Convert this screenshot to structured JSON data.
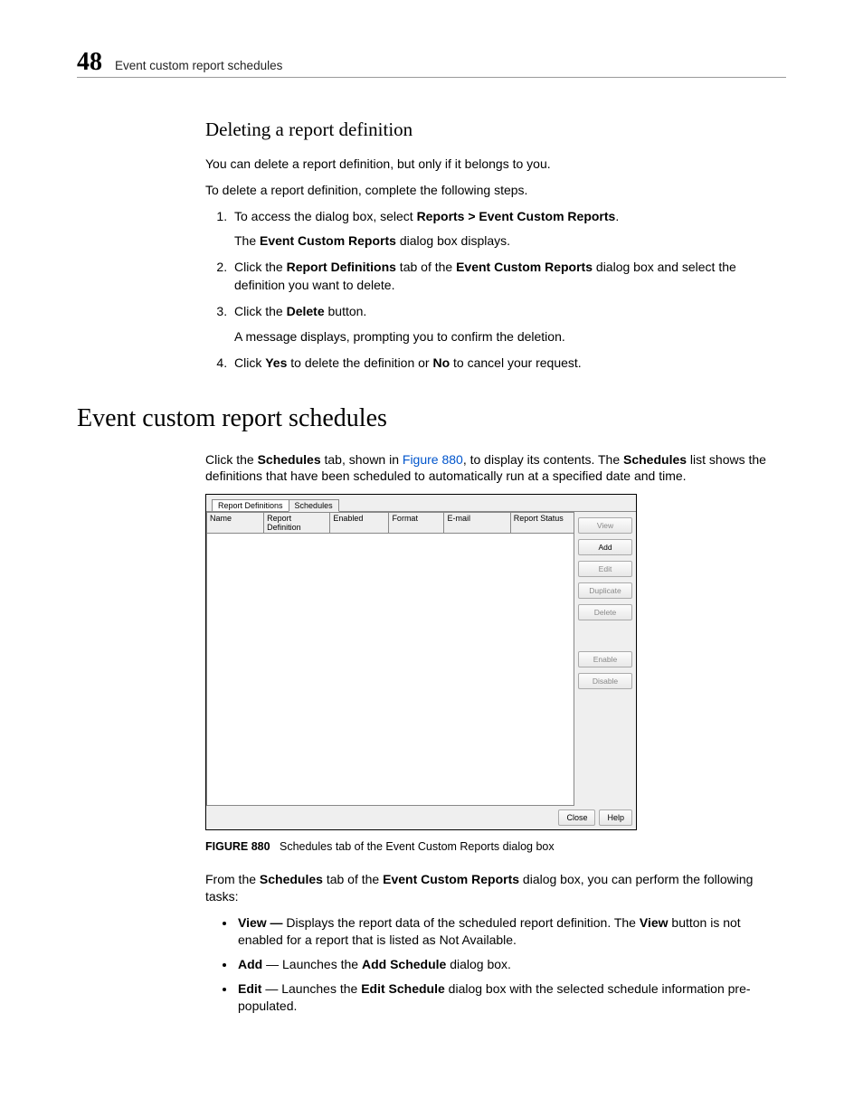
{
  "header": {
    "chapter_number": "48",
    "title": "Event custom report schedules"
  },
  "section1": {
    "heading": "Deleting a report definition",
    "p1": "You can delete a report definition, but only if it belongs to you.",
    "p2": "To delete a report definition, complete the following steps.",
    "steps": {
      "s1_pre": "To access the dialog box, select ",
      "s1_bold": "Reports > Event Custom Reports",
      "s1_post": ".",
      "s1_sub_pre": "The ",
      "s1_sub_bold": "Event Custom Reports",
      "s1_sub_post": " dialog box displays.",
      "s2_pre": "Click the ",
      "s2_bold1": "Report Definitions",
      "s2_mid": " tab of the ",
      "s2_bold2": "Event Custom Reports",
      "s2_post": " dialog box and select the definition you want to delete.",
      "s3_pre": "Click the ",
      "s3_bold": "Delete",
      "s3_post": " button.",
      "s3_sub": "A message displays, prompting you to confirm the deletion.",
      "s4_pre": "Click ",
      "s4_bold1": "Yes",
      "s4_mid": " to delete the definition or ",
      "s4_bold2": "No",
      "s4_post": " to cancel your request."
    }
  },
  "section2": {
    "heading": "Event custom report schedules",
    "intro_pre": "Click the ",
    "intro_bold1": "Schedules",
    "intro_mid1": " tab, shown in ",
    "intro_link": "Figure 880",
    "intro_mid2": ", to display its contents. The ",
    "intro_bold2": "Schedules",
    "intro_post": " list shows the definitions that have been scheduled to automatically run at a specified date and time.",
    "dialog": {
      "tabs": [
        "Report Definitions",
        "Schedules"
      ],
      "columns": [
        "Name",
        "Report Definition",
        "Enabled",
        "Format",
        "E-mail",
        "Report Status"
      ],
      "buttons": {
        "view": "View",
        "add": "Add",
        "edit": "Edit",
        "duplicate": "Duplicate",
        "delete": "Delete",
        "enable": "Enable",
        "disable": "Disable",
        "close": "Close",
        "help": "Help"
      }
    },
    "caption_label": "FIGURE 880",
    "caption_text": "Schedules tab of the Event Custom Reports dialog box",
    "p_after_pre": "From the ",
    "p_after_bold1": "Schedules",
    "p_after_mid": " tab of the ",
    "p_after_bold2": "Event Custom Reports",
    "p_after_post": " dialog box, you can perform the following tasks:",
    "bullets": {
      "b1_bold": "View —",
      "b1_text_pre": " Displays the report data of the scheduled report definition. The ",
      "b1_bold2": "View",
      "b1_text_post": " button is not enabled for a report that is listed as Not Available.",
      "b2_bold": "Add",
      "b2_mid": " — Launches the ",
      "b2_bold2": "Add Schedule",
      "b2_post": " dialog box.",
      "b3_bold": "Edit",
      "b3_mid": " — Launches the ",
      "b3_bold2": "Edit Schedule",
      "b3_post": " dialog box with the selected schedule information pre-populated."
    }
  }
}
